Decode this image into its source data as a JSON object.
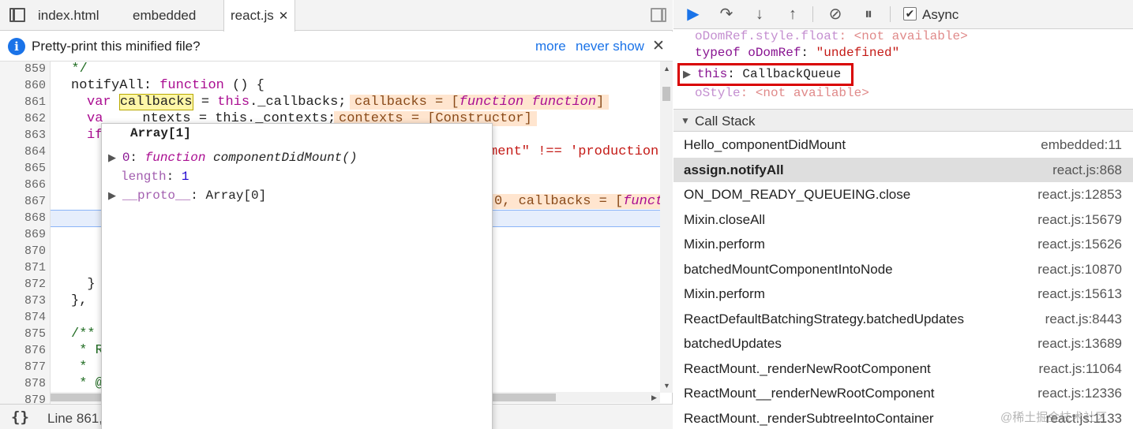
{
  "tabs": [
    {
      "label": "index.html"
    },
    {
      "label": "embedded"
    },
    {
      "label": "react.js",
      "close": "✕"
    }
  ],
  "infobar": {
    "text": "Pretty-print this minified file?",
    "more": "more",
    "never_show": "never show",
    "close": "✕",
    "icon": "info-icon"
  },
  "editor": {
    "line_numbers": [
      "859",
      "860",
      "861",
      "862",
      "863",
      "864",
      "865",
      "866",
      "867",
      "868",
      "869",
      "870",
      "871",
      "872",
      "873",
      "874",
      "875",
      "876",
      "877",
      "878",
      "879"
    ],
    "l859": "  */",
    "l860_a": "notifyAll",
    "l860_b": ": ",
    "l860_c": "function",
    "l860_d": " () {",
    "l861_a": "var ",
    "l861_b": "callbacks",
    "l861_c": " = ",
    "l861_d": "this",
    "l861_e": "._callbacks;",
    "l861_inline_a": "callbacks = [",
    "l861_inline_b": "function function",
    "l861_inline_c": "]",
    "l862_a": "va",
    "l862_b": "ntexts = this._contexts;",
    "l862_inline": "contexts = [Constructor]",
    "l863": "if",
    "l864_a": "ment\" !== 'production",
    "l867_inline_a": "0, callbacks = [",
    "l867_inline_b": "funct",
    "l872": "  }",
    "l873": "},",
    "l875": "/**",
    "l876": " * R",
    "l877": " *",
    "l878": " * @"
  },
  "status": {
    "text": "Line 861,",
    "pretty_icon": "{}"
  },
  "popover": {
    "title": "Array[1]",
    "rows": [
      {
        "key": "0",
        "sep": ": ",
        "kw": "function",
        "value": " componentDidMount()"
      },
      {
        "key": "length",
        "sep": ": ",
        "value": "1"
      },
      {
        "key": "__proto__",
        "sep": ": ",
        "value": "Array[0]"
      }
    ]
  },
  "debugger_toolbar": {
    "icons": [
      "resume-icon",
      "step-over-icon",
      "step-into-icon",
      "step-out-icon",
      "deactivate-breakpoints-icon",
      "pause-on-exceptions-icon"
    ],
    "async_label": "Async",
    "async_checked": "✔"
  },
  "scope": {
    "r1_key": "oDomRef.style.float",
    "r1_sep": ": ",
    "r1_val": "<not available>",
    "r2_key": "typeof oDomRef",
    "r2_sep": ": ",
    "r2_val": "\"undefined\"",
    "r3_key": "this",
    "r3_sep": ": ",
    "r3_val": "CallbackQueue",
    "r4_key": "oStyle",
    "r4_sep": ": ",
    "r4_val": "<not available>"
  },
  "callstack": {
    "title": "Call Stack",
    "frames": [
      {
        "name": "Hello_componentDidMount",
        "location": "embedded:11"
      },
      {
        "name": "assign.notifyAll",
        "location": "react.js:868"
      },
      {
        "name": "ON_DOM_READY_QUEUEING.close",
        "location": "react.js:12853"
      },
      {
        "name": "Mixin.closeAll",
        "location": "react.js:15679"
      },
      {
        "name": "Mixin.perform",
        "location": "react.js:15626"
      },
      {
        "name": "batchedMountComponentIntoNode",
        "location": "react.js:10870"
      },
      {
        "name": "Mixin.perform",
        "location": "react.js:15613"
      },
      {
        "name": "ReactDefaultBatchingStrategy.batchedUpdates",
        "location": "react.js:8443"
      },
      {
        "name": "batchedUpdates",
        "location": "react.js:13689"
      },
      {
        "name": "ReactMount._renderNewRootComponent",
        "location": "react.js:11064"
      },
      {
        "name": "ReactMount__renderNewRootComponent",
        "location": "react.js:12336"
      },
      {
        "name": "ReactMount._renderSubtreeIntoContainer",
        "location": "react.js:1133"
      }
    ]
  },
  "watermark": "@稀土掘金技术社区",
  "colors": {
    "accent": "#1a73e8",
    "highlight_box": "#d90000",
    "selected_frame": "#dedede"
  }
}
